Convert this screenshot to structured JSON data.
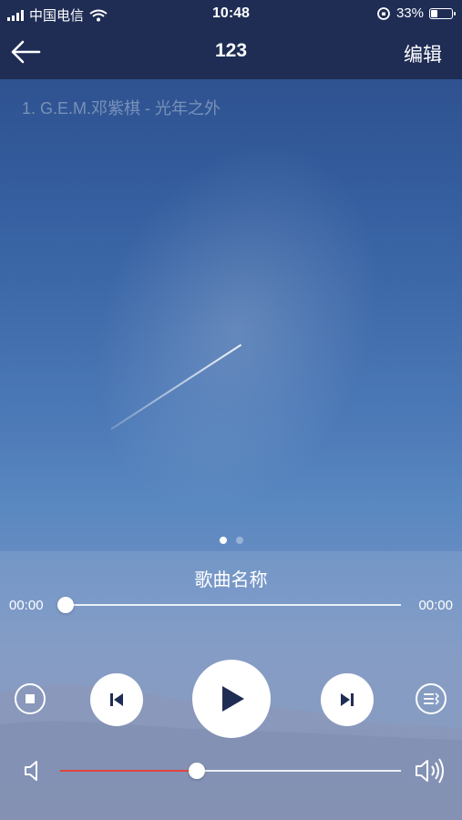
{
  "status_bar": {
    "carrier": "中国电信",
    "time": "10:48",
    "battery_percent": "33%",
    "battery_level": 0.33
  },
  "nav": {
    "title": "123",
    "edit_label": "编辑",
    "back_icon": "back-arrow-icon"
  },
  "lyric_line": "1. G.E.M.邓紫棋 - 光年之外",
  "pager": {
    "pages": 2,
    "active": 0
  },
  "player": {
    "song_name": "歌曲名称",
    "elapsed": "00:00",
    "duration": "00:00",
    "progress": 0.0,
    "volume": 0.4,
    "accent_color": "#e0443c",
    "icons": {
      "stop": "stop-icon",
      "previous": "previous-track-icon",
      "play": "play-icon",
      "next": "next-track-icon",
      "playlist": "playlist-icon",
      "volume_low": "volume-low-icon",
      "volume_high": "volume-high-icon"
    }
  }
}
